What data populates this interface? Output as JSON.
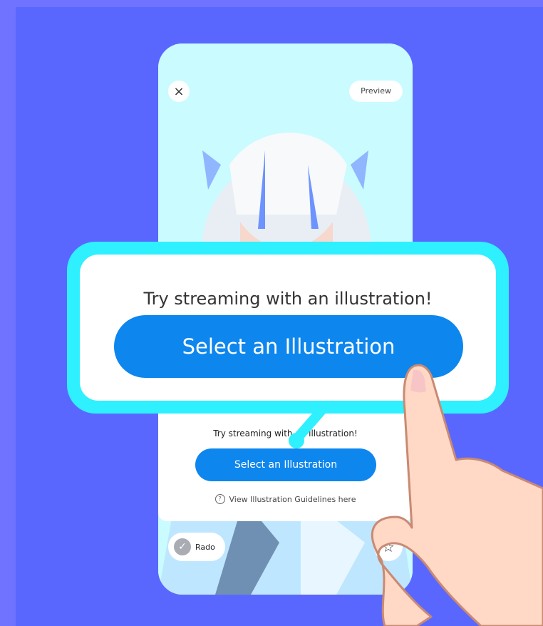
{
  "phone": {
    "close_symbol": "×",
    "preview_label": "Preview",
    "sheet": {
      "title": "Try streaming with an illustration!",
      "button_label": "Select an Illustration",
      "guidelines_label": "View Illustration Guidelines here",
      "guidelines_icon": "?"
    },
    "user_name": "Rado",
    "star_symbol": "☆",
    "avatar_symbol": "✓"
  },
  "callout": {
    "title": "Try streaming with an illustration!",
    "button_label": "Select an Illustration"
  },
  "colors": {
    "background": "#6f73ff",
    "background_inner": "#5a67ff",
    "accent": "#0d86ee",
    "callout_border": "#2ef0ff"
  }
}
